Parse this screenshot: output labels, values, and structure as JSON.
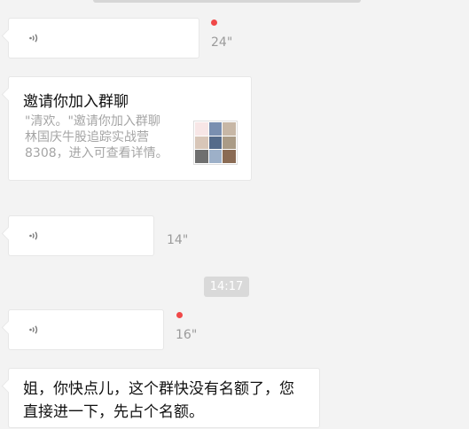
{
  "messages": {
    "voice1": {
      "duration": "24\"",
      "unread": true
    },
    "invite": {
      "title": "邀请你加入群聊",
      "desc": "\"清欢。\"邀请你加入群聊\n林国庆牛股追踪实战营\n8308，进入可查看详情。",
      "thumb_colors": [
        "#f7e6e6",
        "#7a8fb0",
        "#c7b7a6",
        "#d8c6b8",
        "#556b8a",
        "#aa9b86",
        "#6f6f6f",
        "#9db0c8",
        "#8a6b54"
      ]
    },
    "voice2": {
      "duration": "14\"",
      "unread": false
    },
    "timestamp": "14:17",
    "voice3": {
      "duration": "16\"",
      "unread": true
    },
    "text1": "姐，你快点儿，这个群快没有名额了，您\n直接进一下，先占个名额。"
  },
  "colors": {
    "background": "#f3f3f3",
    "unread_dot": "#f04848",
    "time_chip": "#d9d9d9"
  }
}
